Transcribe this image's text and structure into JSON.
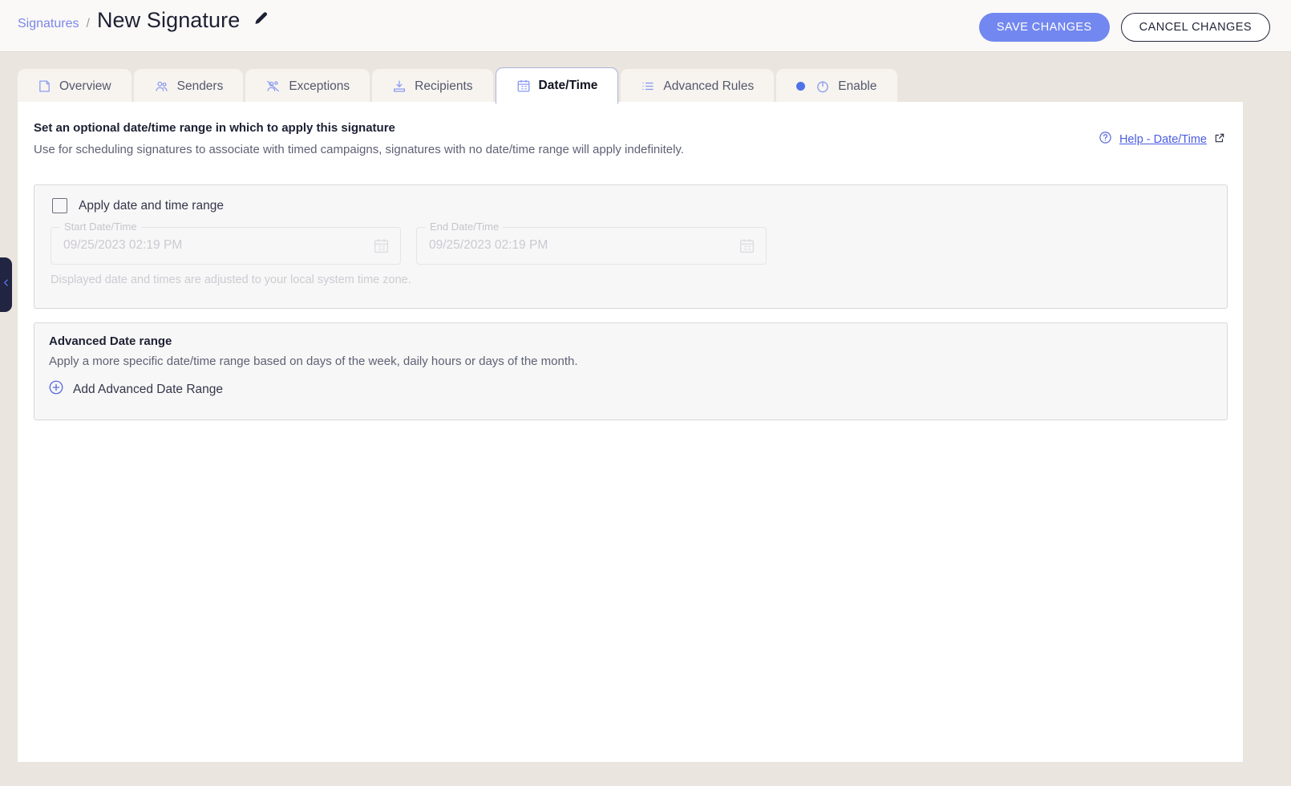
{
  "header": {
    "breadcrumb_parent": "Signatures",
    "breadcrumb_separator": "/",
    "page_title": "New Signature",
    "edit_icon": "pencil-icon",
    "save_label": "SAVE CHANGES",
    "cancel_label": "CANCEL CHANGES",
    "primary_color": "#7287ef"
  },
  "tabs": [
    {
      "label": "Overview",
      "icon": "note-icon",
      "active": false
    },
    {
      "label": "Senders",
      "icon": "users-icon",
      "active": false
    },
    {
      "label": "Exceptions",
      "icon": "users-off-icon",
      "active": false
    },
    {
      "label": "Recipients",
      "icon": "download-inbox-icon",
      "active": false
    },
    {
      "label": "Date/Time",
      "icon": "calendar-icon",
      "active": true
    },
    {
      "label": "Advanced Rules",
      "icon": "list-icon",
      "active": false
    },
    {
      "label": "Enable",
      "icon": "power-icon",
      "active": false,
      "status_dot_color": "#4f72e8"
    }
  ],
  "content": {
    "heading": "Set an optional date/time range in which to apply this signature",
    "subheading": "Use for scheduling signatures to associate with timed campaigns, signatures with no date/time range will apply indefinitely.",
    "help_label": "Help - Date/Time",
    "help_icon": "question-circle-icon",
    "external_icon": "external-link-icon",
    "help_color": "#4a5ce0"
  },
  "date_range_card": {
    "checkbox_label": "Apply date and time range",
    "checkbox_checked": false,
    "start_field": {
      "label": "Start Date/Time",
      "value": "09/25/2023 02:19 PM",
      "icon": "calendar-icon",
      "disabled": true
    },
    "end_field": {
      "label": "End Date/Time",
      "value": "09/25/2023 02:19 PM",
      "icon": "calendar-icon",
      "disabled": true
    },
    "timezone_note": "Displayed date and times are adjusted to your local system time zone."
  },
  "advanced_card": {
    "title": "Advanced Date range",
    "description": "Apply a more specific date/time range based on days of the week, daily hours or days of the month.",
    "add_label": "Add Advanced Date Range",
    "add_icon": "plus-circle-icon"
  },
  "sidebar": {
    "collapse_icon": "chevron-left-icon"
  }
}
